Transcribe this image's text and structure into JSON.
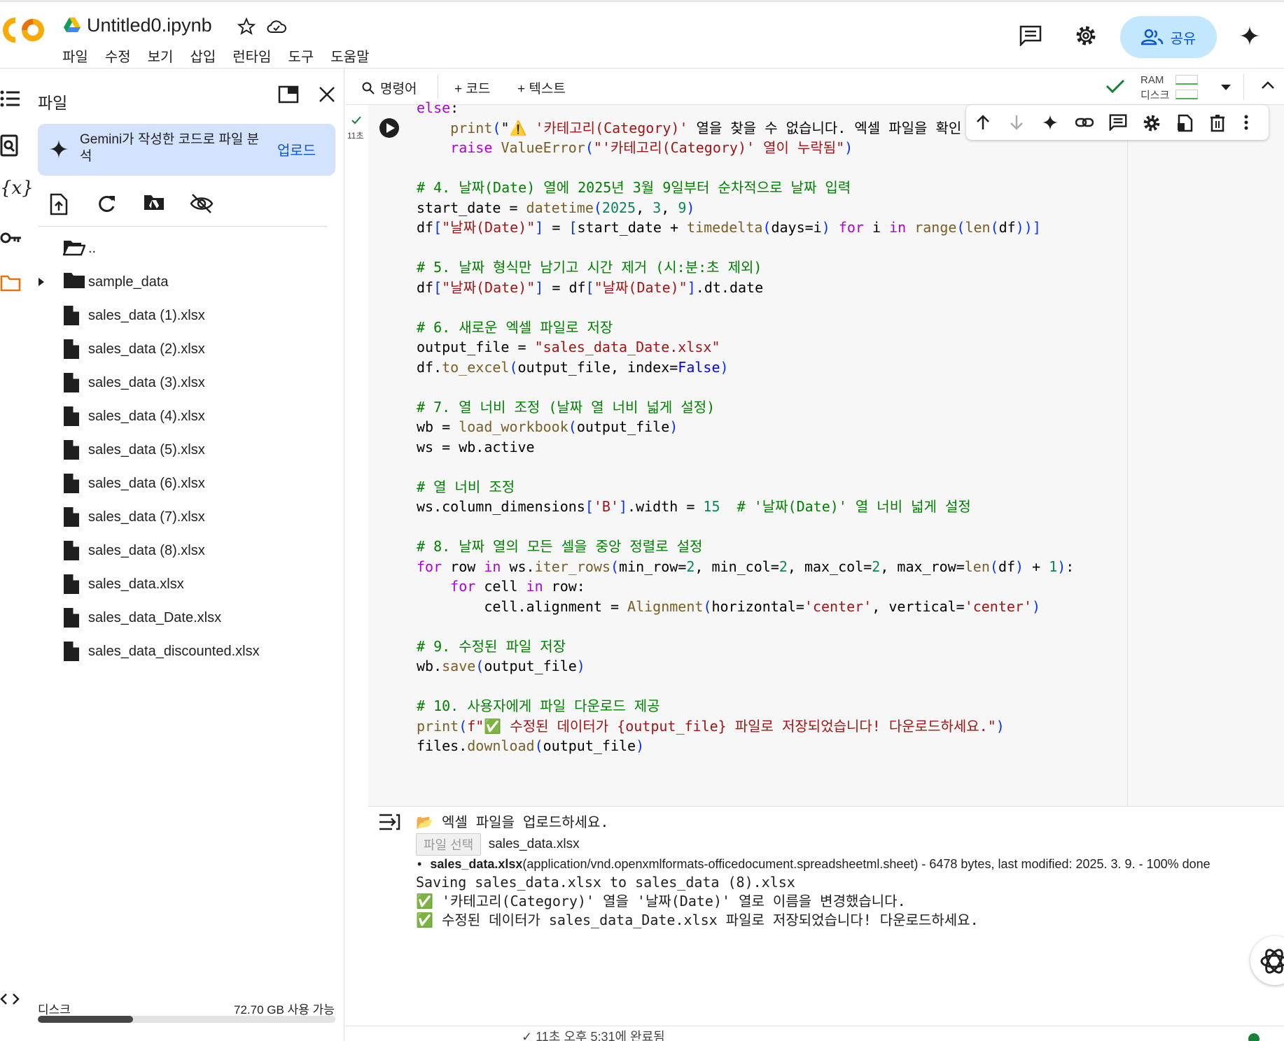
{
  "header": {
    "logo_text": "CO",
    "title": "Untitled0.ipynb",
    "menu": [
      "파일",
      "수정",
      "보기",
      "삽입",
      "런타임",
      "도구",
      "도움말"
    ],
    "share_label": "공유"
  },
  "sidebar": {
    "title": "파일",
    "gemini_banner": {
      "text": "Gemini가 작성한 코드로 파일 분석",
      "upload_label": "업로드"
    },
    "files": [
      {
        "name": "..",
        "type": "folder-open"
      },
      {
        "name": "sample_data",
        "type": "folder"
      },
      {
        "name": "sales_data (1).xlsx",
        "type": "file"
      },
      {
        "name": "sales_data (2).xlsx",
        "type": "file"
      },
      {
        "name": "sales_data (3).xlsx",
        "type": "file"
      },
      {
        "name": "sales_data (4).xlsx",
        "type": "file"
      },
      {
        "name": "sales_data (5).xlsx",
        "type": "file"
      },
      {
        "name": "sales_data (6).xlsx",
        "type": "file"
      },
      {
        "name": "sales_data (7).xlsx",
        "type": "file"
      },
      {
        "name": "sales_data (8).xlsx",
        "type": "file"
      },
      {
        "name": "sales_data.xlsx",
        "type": "file"
      },
      {
        "name": "sales_data_Date.xlsx",
        "type": "file"
      },
      {
        "name": "sales_data_discounted.xlsx",
        "type": "file"
      }
    ],
    "disk_label": "디스크",
    "disk_available": "72.70 GB 사용 가능",
    "disk_used_fraction": 0.32
  },
  "toolbar": {
    "search_label": "명령어",
    "code_label": "+ 코드",
    "text_label": "+ 텍스트",
    "ram_label": "RAM",
    "disk_label": "디스크"
  },
  "cell": {
    "run_time": "11초",
    "code_lines": [
      "else:",
      "    print(\"⚠️ '카테고리(Category)' 열을 찾을 수 없습니다. 엑셀 파일을 확인",
      "    raise ValueError(\"'카테고리(Category)' 열이 누락됨\")",
      "",
      "# 4. 날짜(Date) 열에 2025년 3월 9일부터 순차적으로 날짜 입력",
      "start_date = datetime(2025, 3, 9)",
      "df[\"날짜(Date)\"] = [start_date + timedelta(days=i) for i in range(len(df))]",
      "",
      "# 5. 날짜 형식만 남기고 시간 제거 (시:분:초 제외)",
      "df[\"날짜(Date)\"] = df[\"날짜(Date)\"].dt.date",
      "",
      "# 6. 새로운 엑셀 파일로 저장",
      "output_file = \"sales_data_Date.xlsx\"",
      "df.to_excel(output_file, index=False)",
      "",
      "# 7. 열 너비 조정 (날짜 열 너비 넓게 설정)",
      "wb = load_workbook(output_file)",
      "ws = wb.active",
      "",
      "# 열 너비 조정",
      "ws.column_dimensions['B'].width = 15  # '날짜(Date)' 열 너비 넓게 설정",
      "",
      "# 8. 날짜 열의 모든 셀을 중앙 정렬로 설정",
      "for row in ws.iter_rows(min_row=2, min_col=2, max_col=2, max_row=len(df) + 1):",
      "    for cell in row:",
      "        cell.alignment = Alignment(horizontal='center', vertical='center')",
      "",
      "# 9. 수정된 파일 저장",
      "wb.save(output_file)",
      "",
      "# 10. 사용자에게 파일 다운로드 제공",
      "print(f\"✅ 수정된 데이터가 {output_file} 파일로 저장되었습니다! 다운로드하세요.\")",
      "files.download(output_file)"
    ]
  },
  "output": {
    "upload_prompt": "📂 엑셀 파일을 업로드하세요.",
    "choose_button": "파일 선택",
    "chosen_file": "sales_data.xlsx",
    "file_info_name": "sales_data.xlsx",
    "file_info_rest": "(application/vnd.openxmlformats-officedocument.spreadsheetml.sheet) - 6478 bytes, last modified: 2025. 3. 9. - 100% done",
    "lines": [
      "Saving sales_data.xlsx to sales_data (8).xlsx",
      "✅ '카테고리(Category)' 열을 '날짜(Date)' 열로 이름을 변경했습니다.",
      "✅ 수정된 데이터가 sales_data_Date.xlsx 파일로 저장되었습니다! 다운로드하세요."
    ]
  },
  "statusbar": {
    "text": "✓ 11초   오후 5:31에 완료됨"
  },
  "colors": {
    "accent": "#0b57d0",
    "share_bg": "#c2e7ff",
    "banner_bg": "#d3e3fd",
    "logo_orange": "#f9ab00",
    "logo_dark_orange": "#e8710a"
  }
}
